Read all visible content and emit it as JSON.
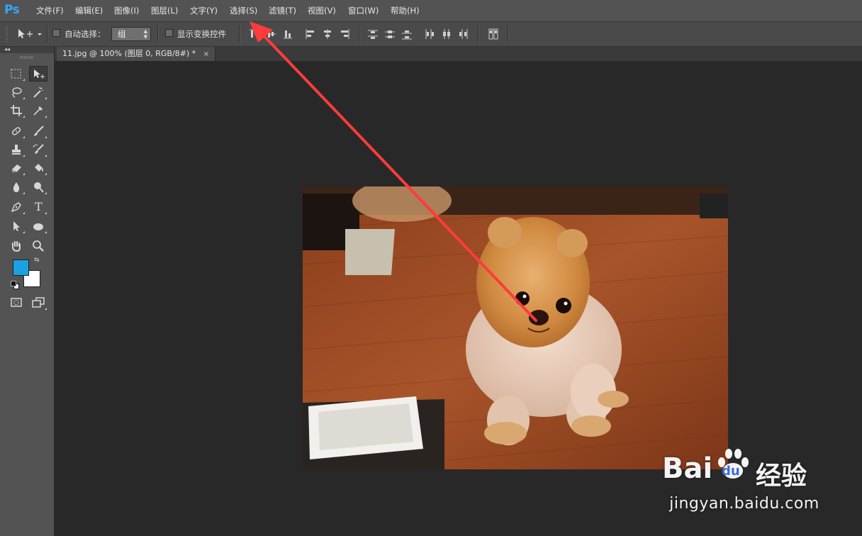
{
  "app": {
    "logo_text": "Ps",
    "accent": "#31a8ff"
  },
  "menu": [
    {
      "id": "file",
      "label": "文件(F)"
    },
    {
      "id": "edit",
      "label": "编辑(E)"
    },
    {
      "id": "image",
      "label": "图像(I)"
    },
    {
      "id": "layer",
      "label": "图层(L)"
    },
    {
      "id": "type",
      "label": "文字(Y)"
    },
    {
      "id": "select",
      "label": "选择(S)"
    },
    {
      "id": "filter",
      "label": "滤镜(T)"
    },
    {
      "id": "view",
      "label": "视图(V)"
    },
    {
      "id": "window",
      "label": "窗口(W)"
    },
    {
      "id": "help",
      "label": "帮助(H)"
    }
  ],
  "options": {
    "auto_select_label": "自动选择：",
    "auto_select_checked": false,
    "auto_select_value": "组",
    "show_transform_label": "显示变换控件",
    "show_transform_checked": false
  },
  "document": {
    "tab_title": "11.jpg @ 100% (图层 0, RGB/8#) *",
    "close_symbol": "×"
  },
  "colors": {
    "foreground": "#1ba1e2",
    "background": "#ffffff",
    "annotation_arrow": "#ff3b3b"
  },
  "tools": [
    "marquee-tool",
    "move-tool",
    "lasso-tool",
    "magic-wand-tool",
    "crop-tool",
    "eyedropper-tool",
    "healing-brush-tool",
    "brush-tool",
    "clone-stamp-tool",
    "history-brush-tool",
    "eraser-tool",
    "paint-bucket-tool",
    "blur-tool",
    "dodge-tool",
    "pen-tool",
    "type-tool",
    "path-selection-tool",
    "ellipse-tool",
    "hand-tool",
    "zoom-tool",
    "quick-mask",
    "screen-mode"
  ],
  "type_tool_glyph": "T",
  "watermark": {
    "brand_latin": "Bai",
    "brand_du": "du",
    "brand_cn": "经验",
    "url": "jingyan.baidu.com"
  }
}
